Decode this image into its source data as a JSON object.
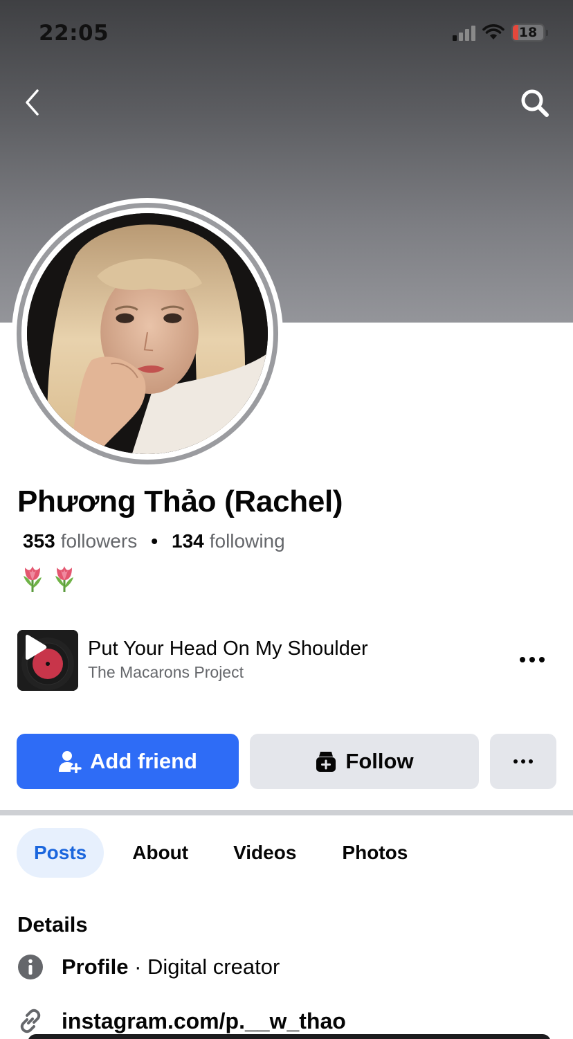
{
  "status_bar": {
    "time": "22:05",
    "battery": "18",
    "battery_level_percent": 18
  },
  "nav": {
    "back_icon": "chevron-left-icon",
    "search_icon": "search-icon"
  },
  "profile": {
    "name": "Phương Thảo (Rachel)",
    "followers_count": "353",
    "followers_label": "followers",
    "following_count": "134",
    "following_label": "following",
    "separator": "•",
    "bio_emoji": [
      "🌷",
      "🌷"
    ]
  },
  "music": {
    "title": "Put Your Head On My Shoulder",
    "artist": "The Macarons Project"
  },
  "actions": {
    "add_friend_label": "Add friend",
    "follow_label": "Follow"
  },
  "tabs": [
    {
      "label": "Posts",
      "active": true
    },
    {
      "label": "About",
      "active": false
    },
    {
      "label": "Videos",
      "active": false
    },
    {
      "label": "Photos",
      "active": false
    }
  ],
  "details": {
    "title": "Details",
    "profile_label": "Profile",
    "profile_separator": " · ",
    "profile_value": "Digital creator",
    "link": "instagram.com/p.__w_thao"
  },
  "colors": {
    "accent_blue": "#2e6cf6",
    "tab_active_text": "#1b66dd",
    "tab_active_bg": "#e7f0fd",
    "button_gray": "#e4e6eb",
    "secondary_text": "#65676b"
  }
}
